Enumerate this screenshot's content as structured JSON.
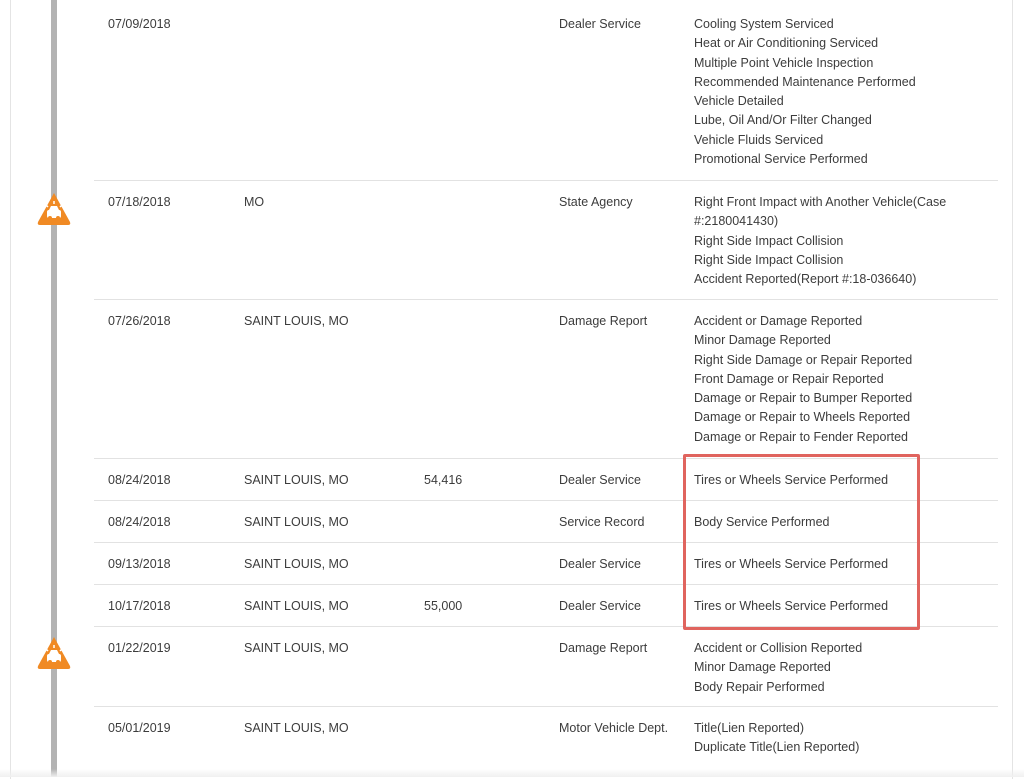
{
  "colors": {
    "timeline": "#b3b3b3",
    "accident_icon": "#f08a24",
    "highlight": "#e0645e",
    "divider": "#e2e2e2"
  },
  "records": [
    {
      "date": "07/09/2018",
      "location": "",
      "odometer": "",
      "source": "Dealer Service",
      "details": [
        "Cooling System Serviced",
        "Heat or Air Conditioning Serviced",
        "Multiple Point Vehicle Inspection",
        "Recommended Maintenance Performed",
        "Vehicle Detailed",
        "Lube, Oil And/Or Filter Changed",
        "Vehicle Fluids Serviced",
        "Promotional Service Performed"
      ]
    },
    {
      "date": "07/18/2018",
      "location": "MO",
      "odometer": "",
      "source": "State Agency",
      "details": [
        "Right Front Impact with Another Vehicle(Case",
        "#:2180041430)",
        "Right Side Impact Collision",
        "Right Side Impact Collision",
        "Accident Reported(Report #:18-036640)"
      ]
    },
    {
      "date": "07/26/2018",
      "location": "SAINT LOUIS, MO",
      "odometer": "",
      "source": "Damage Report",
      "details": [
        "Accident or Damage Reported",
        "Minor Damage Reported",
        "Right Side Damage or Repair Reported",
        "Front Damage or Repair Reported",
        "Damage or Repair to Bumper Reported",
        "Damage or Repair to Wheels Reported",
        "Damage or Repair to Fender Reported"
      ]
    },
    {
      "date": "08/24/2018",
      "location": "SAINT LOUIS, MO",
      "odometer": "54,416",
      "source": "Dealer Service",
      "details": [
        "Tires or Wheels Service Performed"
      ]
    },
    {
      "date": "08/24/2018",
      "location": "SAINT LOUIS, MO",
      "odometer": "",
      "source": "Service Record",
      "details": [
        "Body Service Performed"
      ]
    },
    {
      "date": "09/13/2018",
      "location": "SAINT LOUIS, MO",
      "odometer": "",
      "source": "Dealer Service",
      "details": [
        "Tires or Wheels Service Performed"
      ]
    },
    {
      "date": "10/17/2018",
      "location": "SAINT LOUIS, MO",
      "odometer": "55,000",
      "source": "Dealer Service",
      "details": [
        "Tires or Wheels Service Performed"
      ]
    },
    {
      "date": "01/22/2019",
      "location": "SAINT LOUIS, MO",
      "odometer": "",
      "source": "Damage Report",
      "details": [
        "Accident or Collision Reported",
        "Minor Damage Reported",
        "Body Repair Performed"
      ]
    },
    {
      "date": "05/01/2019",
      "location": "SAINT LOUIS, MO",
      "odometer": "",
      "source": "Motor Vehicle Dept.",
      "details": [
        "Title(Lien Reported)",
        "Duplicate Title(Lien Reported)"
      ]
    }
  ]
}
